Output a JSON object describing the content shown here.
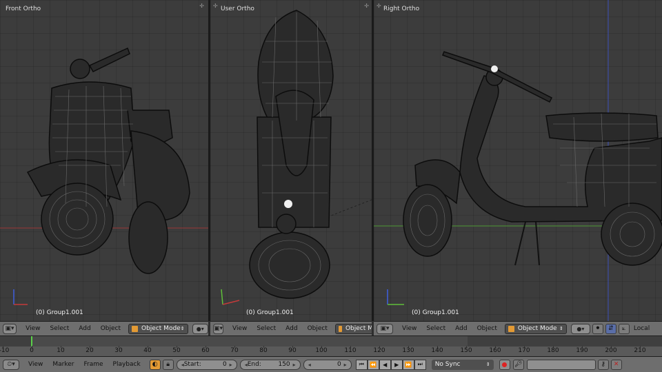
{
  "viewports": [
    {
      "label": "Front Ortho",
      "object": "(0) Group1.001"
    },
    {
      "label": "User Ortho",
      "object": "(0) Group1.001"
    },
    {
      "label": "Right Ortho",
      "object": "(0) Group1.001"
    }
  ],
  "header_left": {
    "view": "View",
    "select": "Select",
    "add": "Add",
    "object": "Object",
    "mode": "Object Mode"
  },
  "header_mid": {
    "view": "View",
    "select": "Select",
    "add": "Add",
    "object": "Object",
    "mode": "Object M"
  },
  "header_right": {
    "view": "View",
    "select": "Select",
    "add": "Add",
    "object": "Object",
    "mode": "Object Mode",
    "pivot": "Local"
  },
  "timeline": {
    "ticks": [
      "-10",
      "0",
      "10",
      "20",
      "30",
      "40",
      "50",
      "60",
      "70",
      "80",
      "90",
      "100",
      "110",
      "120",
      "130",
      "140",
      "150",
      "160",
      "170",
      "180",
      "190",
      "200",
      "210"
    ],
    "current_frame": 0
  },
  "bottom_bar": {
    "view": "View",
    "marker": "Marker",
    "frame": "Frame",
    "playback": "Playback",
    "start_label": "Start:",
    "start_value": "0",
    "end_label": "End:",
    "end_value": "150",
    "current_value": "0",
    "sync": "No Sync"
  },
  "colors": {
    "accent_orange": "#e39a34",
    "frame_cursor": "#5bd14a",
    "record": "#dd2222",
    "x_axis": "#c53a3a",
    "y_axis": "#5fbf3a",
    "z_axis": "#3f5fe0"
  }
}
